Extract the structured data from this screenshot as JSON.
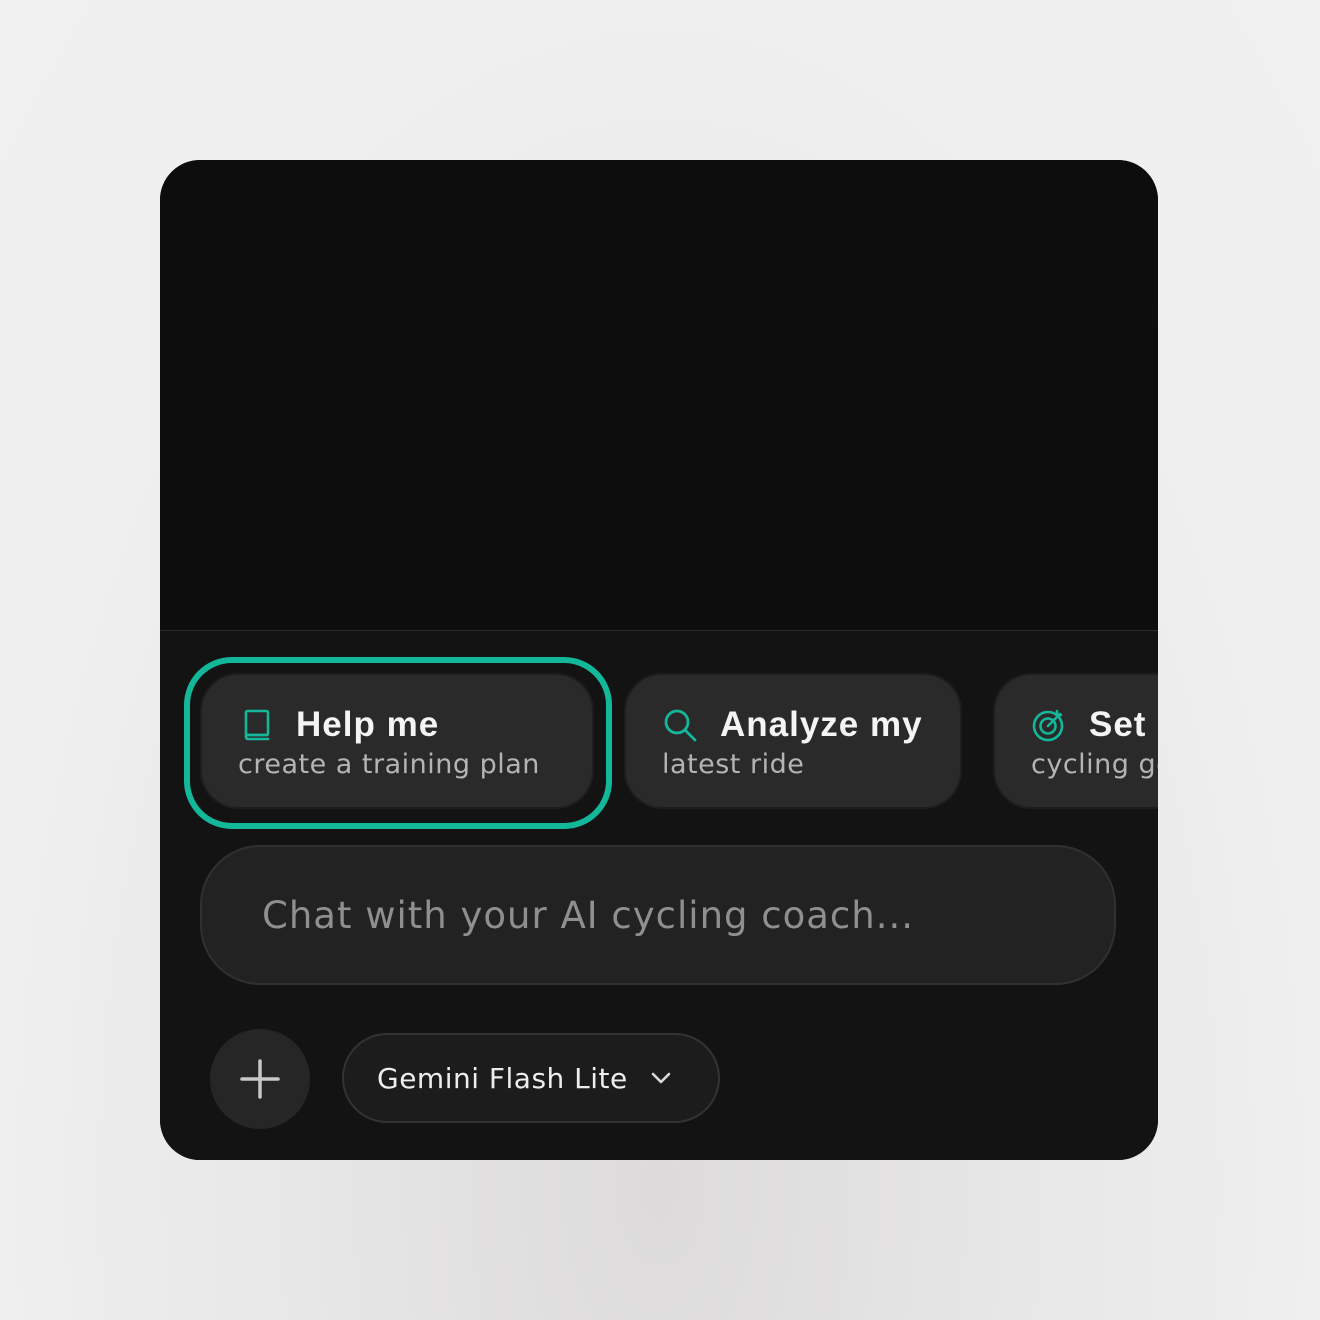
{
  "colors": {
    "accent": "#13b89a",
    "window_background": "#0d0d0d",
    "composer_background": "#131313",
    "chip_background": "#2a2a2a"
  },
  "suggestions": [
    {
      "icon": "book-icon",
      "title": "Help me",
      "subtitle": "create a training plan",
      "highlighted": true
    },
    {
      "icon": "search-icon",
      "title": "Analyze my",
      "subtitle": "latest ride",
      "highlighted": false
    },
    {
      "icon": "target-icon",
      "title": "Set",
      "subtitle": "cycling goals",
      "highlighted": false
    }
  ],
  "composer": {
    "placeholder": "Chat with your AI cycling coach...",
    "value": ""
  },
  "toolbar": {
    "add_icon": "plus-icon",
    "model_label": "Gemini Flash Lite",
    "model_icon": "chevron-down-icon"
  }
}
